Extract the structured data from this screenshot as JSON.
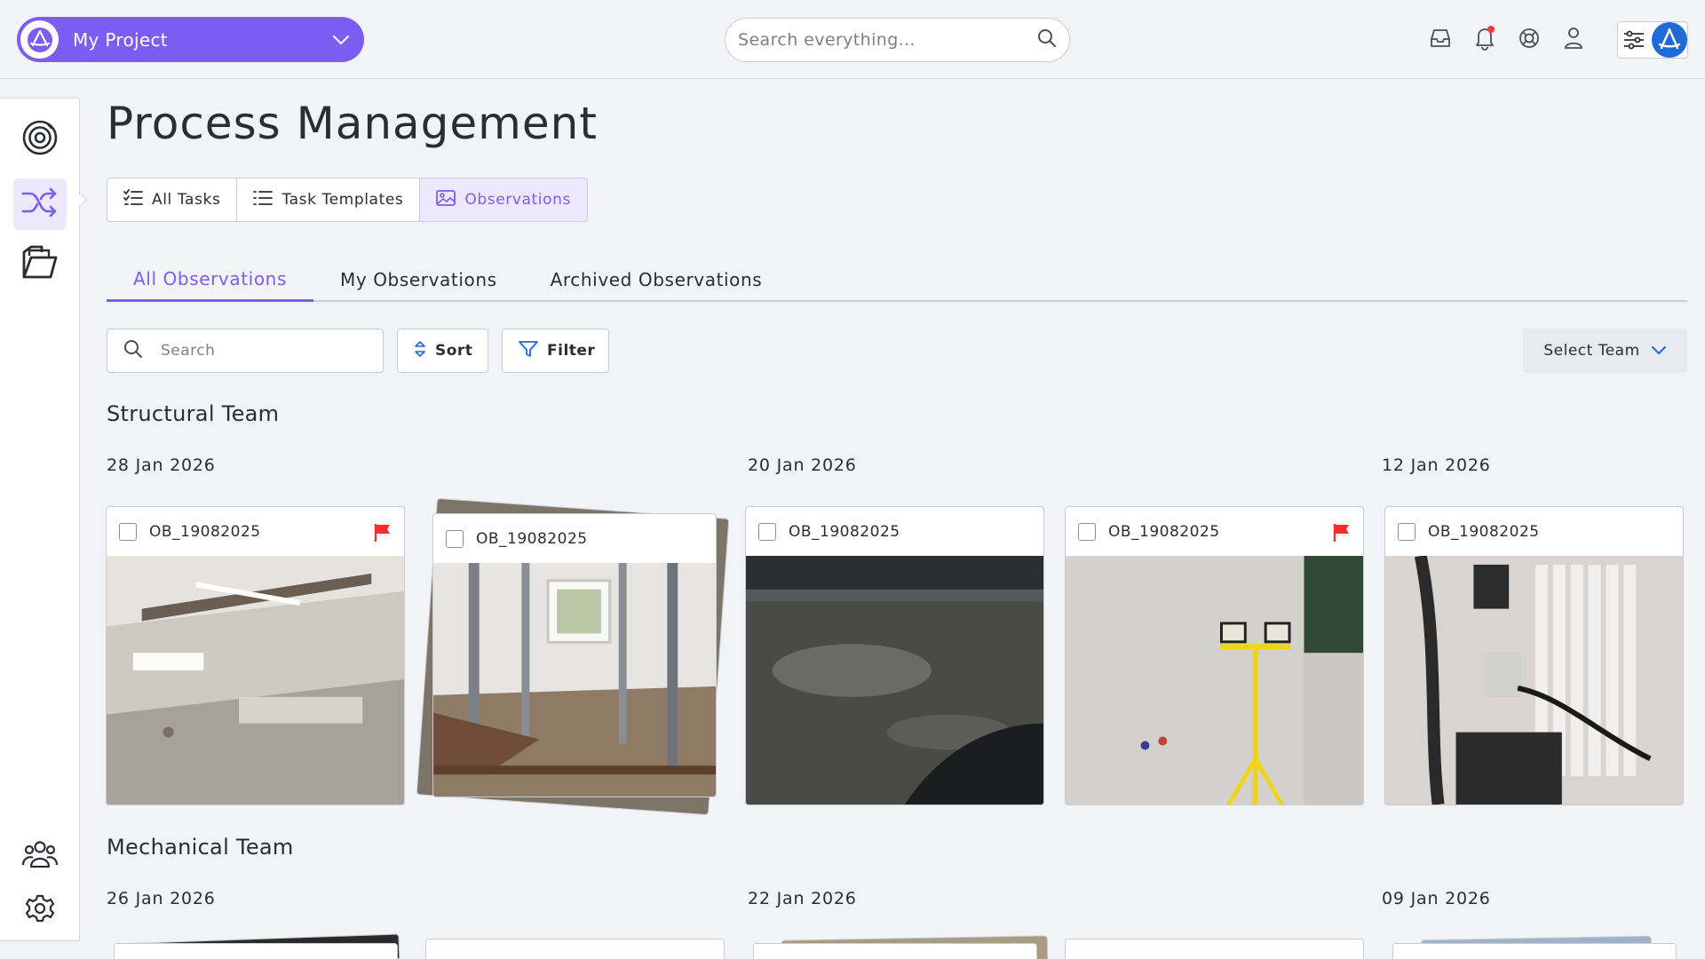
{
  "header": {
    "project_name": "My Project",
    "search_placeholder": "Search everything...",
    "icons": [
      "inbox-icon",
      "bell-icon",
      "support-icon",
      "user-icon",
      "sliders-icon"
    ],
    "has_notification": true
  },
  "sidebar": {
    "items": [
      {
        "name": "target-icon",
        "active": false
      },
      {
        "name": "shuffle-icon",
        "active": true
      },
      {
        "name": "folder-icon",
        "active": false
      },
      {
        "name": "users-icon",
        "active": false
      },
      {
        "name": "gear-icon",
        "active": false
      }
    ]
  },
  "page": {
    "title": "Process Management",
    "views": [
      {
        "label": "All Tasks",
        "icon": "checklist-icon",
        "active": false
      },
      {
        "label": "Task Templates",
        "icon": "list-icon",
        "active": false
      },
      {
        "label": "Observations",
        "icon": "image-icon",
        "active": true
      }
    ],
    "subtabs": [
      {
        "label": "All Observations",
        "active": true
      },
      {
        "label": "My Observations",
        "active": false
      },
      {
        "label": "Archived Observations",
        "active": false
      }
    ],
    "search_placeholder": "Search",
    "sort_label": "Sort",
    "filter_label": "Filter",
    "team_select_label": "Select Team"
  },
  "groups": [
    {
      "title": "Structural Team",
      "dates": [
        "28 Jan 2026",
        "20 Jan 2026",
        "12 Jan 2026"
      ],
      "cards": [
        {
          "id": "OB_19082025",
          "flagged": true,
          "stacked": false,
          "image": "interior-drywall-room"
        },
        {
          "id": "OB_19082025",
          "flagged": false,
          "stacked": true,
          "image": "demolition-with-props"
        },
        {
          "id": "OB_19082025",
          "flagged": false,
          "stacked": false,
          "image": "dark-floor-threshold"
        },
        {
          "id": "OB_19082025",
          "flagged": true,
          "stacked": false,
          "image": "wall-with-floodlights"
        },
        {
          "id": "OB_19082025",
          "flagged": false,
          "stacked": false,
          "image": "radiator-and-pipes"
        }
      ]
    },
    {
      "title": "Mechanical Team",
      "dates": [
        "26 Jan 2026",
        "22 Jan 2026",
        "09 Jan 2026"
      ]
    }
  ],
  "colors": {
    "accent": "#7c5cf2",
    "accent_light": "#ece8fd",
    "flag": "#ff2b2b",
    "background": "#f2f3f6",
    "border": "#c9ccd3"
  }
}
